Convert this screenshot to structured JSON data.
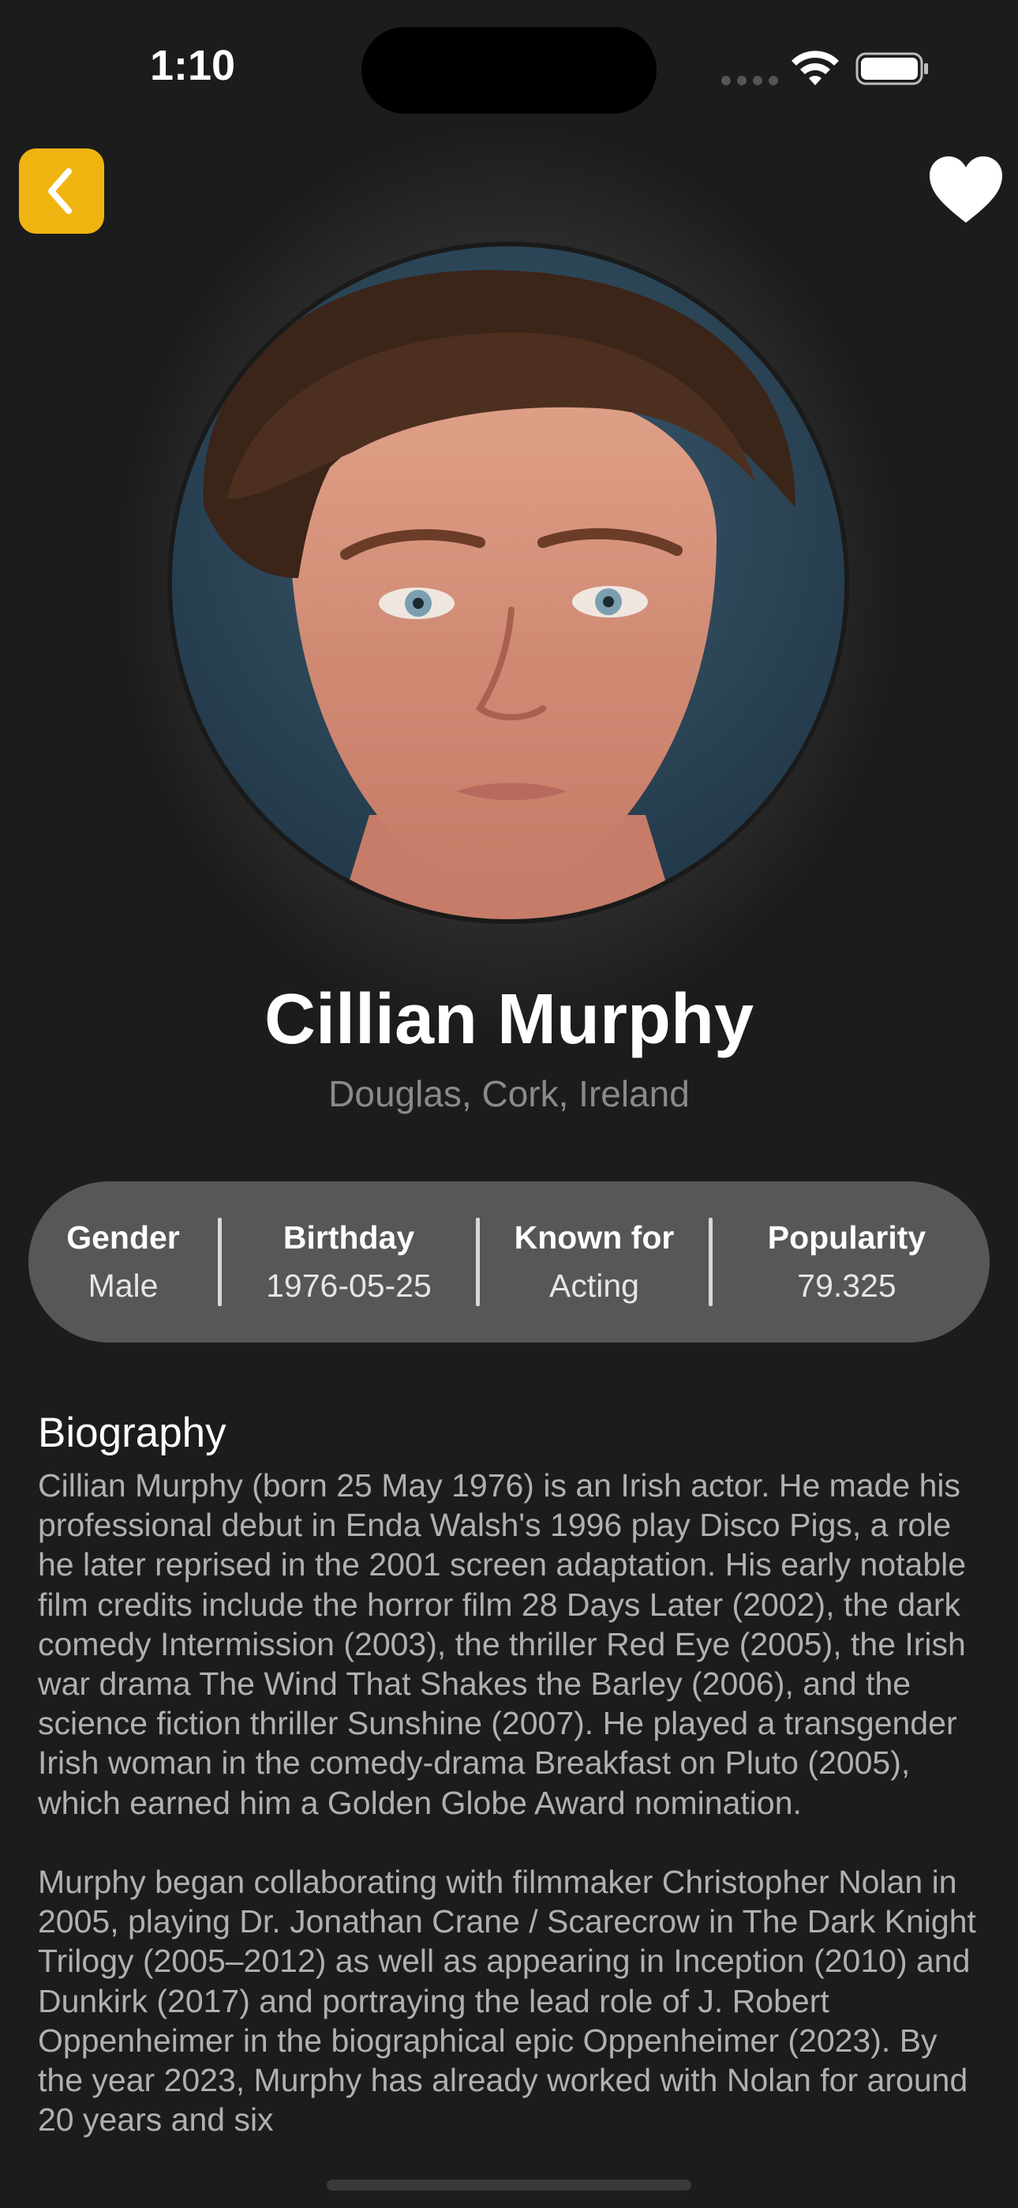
{
  "status_bar": {
    "time": "1:10"
  },
  "nav": {
    "back_icon": "chevron-left-icon",
    "favorite_icon": "heart-icon",
    "accent_color": "#f0b411"
  },
  "actor": {
    "name": "Cillian Murphy",
    "place_of_birth": "Douglas, Cork, Ireland"
  },
  "stats": [
    {
      "label": "Gender",
      "value": "Male"
    },
    {
      "label": "Birthday",
      "value": "1976-05-25"
    },
    {
      "label": "Known for",
      "value": "Acting"
    },
    {
      "label": "Popularity",
      "value": "79.325"
    }
  ],
  "biography": {
    "heading": "Biography",
    "paragraph_1": "Cillian Murphy (born 25 May 1976) is an Irish actor. He made his professional debut in Enda Walsh's 1996 play Disco Pigs, a role he later reprised in the 2001 screen adaptation. His early notable film credits include the horror film 28 Days Later (2002), the dark comedy Intermission (2003), the thriller Red Eye (2005), the Irish war drama The Wind That Shakes the Barley (2006), and the science fiction thriller Sunshine (2007). He played a transgender Irish woman in the comedy-drama Breakfast on Pluto (2005), which earned him a Golden Globe Award nomination.",
    "paragraph_2": "Murphy began collaborating with filmmaker Christopher Nolan in 2005, playing Dr. Jonathan Crane / Scarecrow in The Dark Knight Trilogy (2005–2012) as well as appearing in Inception (2010) and Dunkirk (2017) and portraying the lead role of J. Robert Oppenheimer in the biographical epic Oppenheimer (2023). By the year 2023, Murphy has already worked with Nolan for around 20 years and six"
  }
}
